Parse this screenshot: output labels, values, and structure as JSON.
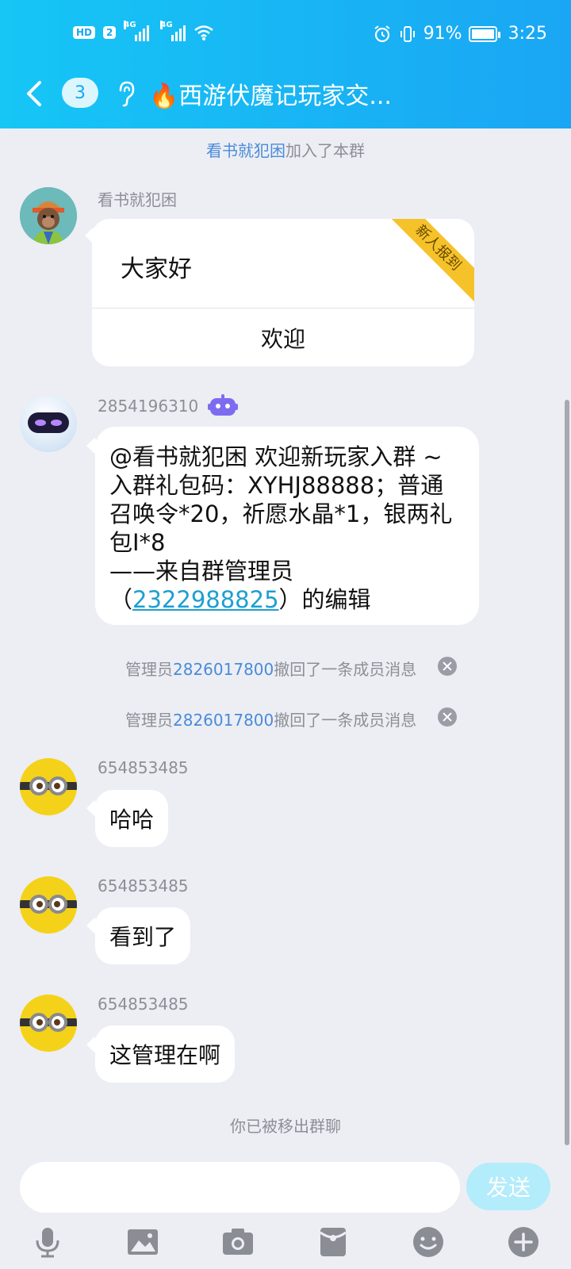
{
  "status_bar": {
    "network_badge": "HD",
    "sim_badge": "2",
    "signal_1": "4G",
    "signal_2": "4G",
    "battery_percent": "91%",
    "time": "3:25"
  },
  "header": {
    "unread_count": "3",
    "group_name": "🔥西游伏魔记玩家交..."
  },
  "messages": {
    "join_notice_user": "看书就犯困",
    "join_notice_text": "加入了本群",
    "msg1_sender": "看书就犯困",
    "msg1_card_text": "大家好",
    "msg1_card_ribbon": "新人报到",
    "msg1_card_button": "欢迎",
    "msg2_sender": "2854196310",
    "msg2_line1": "@看书就犯困 欢迎新玩家入群 ~",
    "msg2_line2": "入群礼包码：XYHJ88888；普通",
    "msg2_line3": "召唤令*20，祈愿水晶*1，银两礼",
    "msg2_line4": "包I*8",
    "msg2_line5": "——来自群管理员",
    "msg2_line6_prefix": "（",
    "msg2_line6_qq": "2322988825",
    "msg2_line6_suffix": "）的编辑",
    "recall_prefix": "管理员",
    "recall_admin": "2826017800",
    "recall_suffix": "撤回了一条成员消息",
    "msg3_sender": "654853485",
    "msg3_text": "哈哈",
    "msg4_sender": "654853485",
    "msg4_text": "看到了",
    "msg5_sender": "654853485",
    "msg5_text": "这管理在啊",
    "removed_notice": "你已被移出群聊"
  },
  "input": {
    "placeholder": "",
    "send_label": "发送"
  },
  "toolbar": [
    "mic-icon",
    "image-icon",
    "camera-icon",
    "red-packet-icon",
    "emoji-icon",
    "plus-icon"
  ],
  "colors": {
    "header_start": "#16c6f5",
    "header_end": "#1aa6f4",
    "link": "#4a8bd8",
    "ribbon": "#f5c22a",
    "send_button": "#b3ecfb"
  }
}
